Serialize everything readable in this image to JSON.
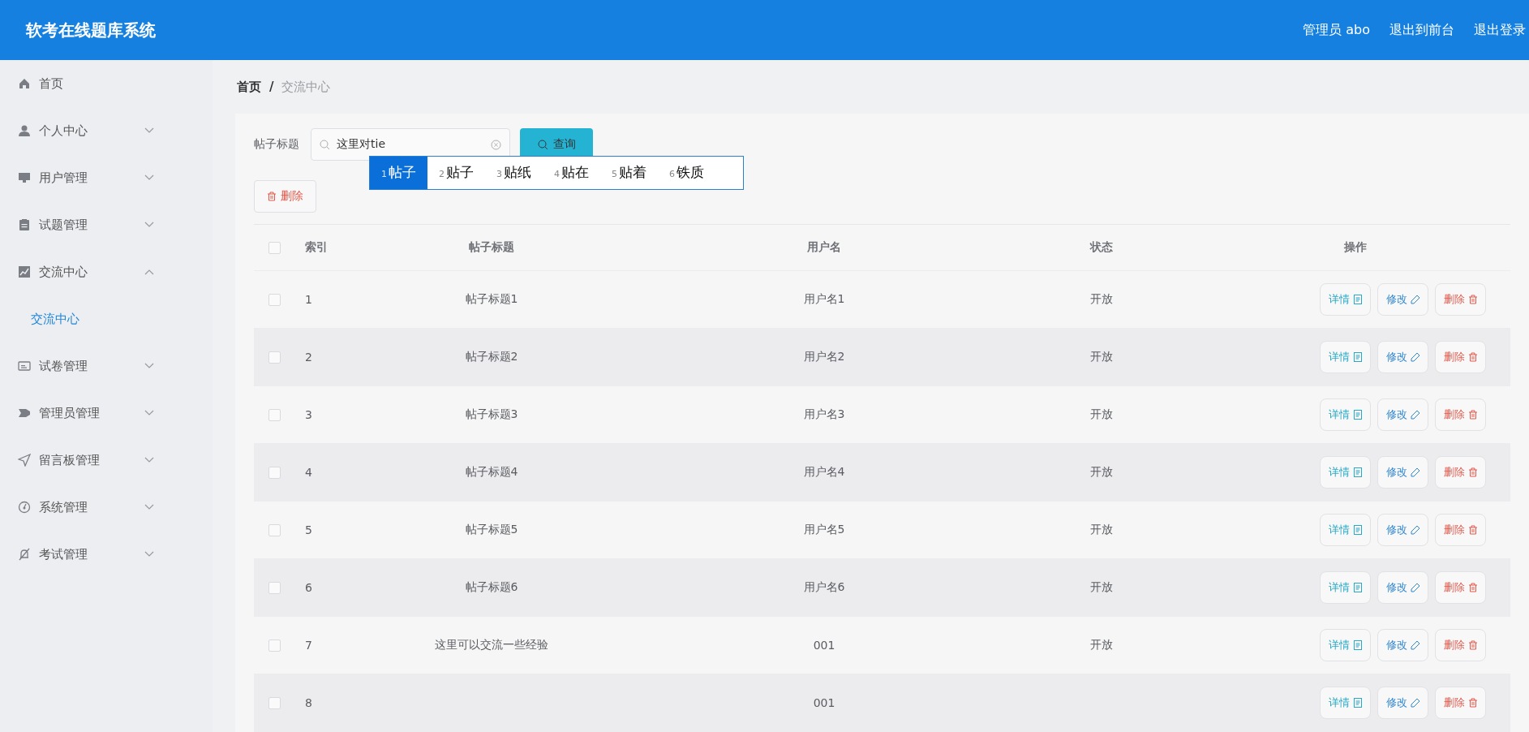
{
  "header": {
    "title": "软考在线题库系统",
    "links": [
      "管理员 abo",
      "退出到前台",
      "退出登录"
    ]
  },
  "sidebar": {
    "items": [
      {
        "label": "首页",
        "kind": "link"
      },
      {
        "label": "个人中心",
        "kind": "submenu",
        "expanded": false
      },
      {
        "label": "用户管理",
        "kind": "submenu",
        "expanded": false
      },
      {
        "label": "试题管理",
        "kind": "submenu",
        "expanded": false
      },
      {
        "label": "交流中心",
        "kind": "submenu",
        "expanded": true,
        "children": [
          {
            "label": "交流中心",
            "selected": true
          }
        ]
      },
      {
        "label": "试卷管理",
        "kind": "submenu",
        "expanded": false
      },
      {
        "label": "管理员管理",
        "kind": "submenu",
        "expanded": false
      },
      {
        "label": "留言板管理",
        "kind": "submenu",
        "expanded": false
      },
      {
        "label": "系统管理",
        "kind": "submenu",
        "expanded": false
      },
      {
        "label": "考试管理",
        "kind": "submenu",
        "expanded": false
      }
    ]
  },
  "breadcrumb": {
    "items": [
      "首页",
      "交流中心"
    ],
    "separator": "/"
  },
  "search": {
    "label": "帖子标题",
    "value": "这里对tie",
    "button": "查询"
  },
  "ime": {
    "candidates": [
      {
        "number": "1",
        "word": "帖子",
        "selected": true
      },
      {
        "number": "2",
        "word": "贴子",
        "selected": false
      },
      {
        "number": "3",
        "word": "贴纸",
        "selected": false
      },
      {
        "number": "4",
        "word": "贴在",
        "selected": false
      },
      {
        "number": "5",
        "word": "贴着",
        "selected": false
      },
      {
        "number": "6",
        "word": "铁质",
        "selected": false
      }
    ]
  },
  "toolbar": {
    "delete_button": "删除"
  },
  "table": {
    "all_checked": false,
    "columns": [
      "索引",
      "帖子标题",
      "用户名",
      "状态",
      "操作"
    ],
    "rows": [
      {
        "checked": false,
        "index": "1",
        "title": "帖子标题1",
        "username": "用户名1",
        "status": "开放",
        "actions": [
          {
            "kind": "detail",
            "label": "详情"
          },
          {
            "kind": "edit",
            "label": "修改"
          },
          {
            "kind": "delete",
            "label": "删除"
          }
        ]
      },
      {
        "checked": false,
        "index": "2",
        "title": "帖子标题2",
        "username": "用户名2",
        "status": "开放",
        "actions": [
          {
            "kind": "detail",
            "label": "详情"
          },
          {
            "kind": "edit",
            "label": "修改"
          },
          {
            "kind": "delete",
            "label": "删除"
          }
        ]
      },
      {
        "checked": false,
        "index": "3",
        "title": "帖子标题3",
        "username": "用户名3",
        "status": "开放",
        "actions": [
          {
            "kind": "detail",
            "label": "详情"
          },
          {
            "kind": "edit",
            "label": "修改"
          },
          {
            "kind": "delete",
            "label": "删除"
          }
        ]
      },
      {
        "checked": false,
        "index": "4",
        "title": "帖子标题4",
        "username": "用户名4",
        "status": "开放",
        "actions": [
          {
            "kind": "detail",
            "label": "详情"
          },
          {
            "kind": "edit",
            "label": "修改"
          },
          {
            "kind": "delete",
            "label": "删除"
          }
        ]
      },
      {
        "checked": false,
        "index": "5",
        "title": "帖子标题5",
        "username": "用户名5",
        "status": "开放",
        "actions": [
          {
            "kind": "detail",
            "label": "详情"
          },
          {
            "kind": "edit",
            "label": "修改"
          },
          {
            "kind": "delete",
            "label": "删除"
          }
        ]
      },
      {
        "checked": false,
        "index": "6",
        "title": "帖子标题6",
        "username": "用户名6",
        "status": "开放",
        "actions": [
          {
            "kind": "detail",
            "label": "详情"
          },
          {
            "kind": "edit",
            "label": "修改"
          },
          {
            "kind": "delete",
            "label": "删除"
          }
        ]
      },
      {
        "checked": false,
        "index": "7",
        "title": "这里可以交流一些经验",
        "username": "001",
        "status": "开放",
        "actions": [
          {
            "kind": "detail",
            "label": "详情"
          },
          {
            "kind": "edit",
            "label": "修改"
          },
          {
            "kind": "delete",
            "label": "删除"
          }
        ]
      },
      {
        "checked": false,
        "index": "8",
        "username": "001",
        "actions": [
          {
            "kind": "detail",
            "label": "详情"
          },
          {
            "kind": "edit",
            "label": "修改"
          },
          {
            "kind": "delete",
            "label": "删除"
          }
        ]
      }
    ]
  }
}
